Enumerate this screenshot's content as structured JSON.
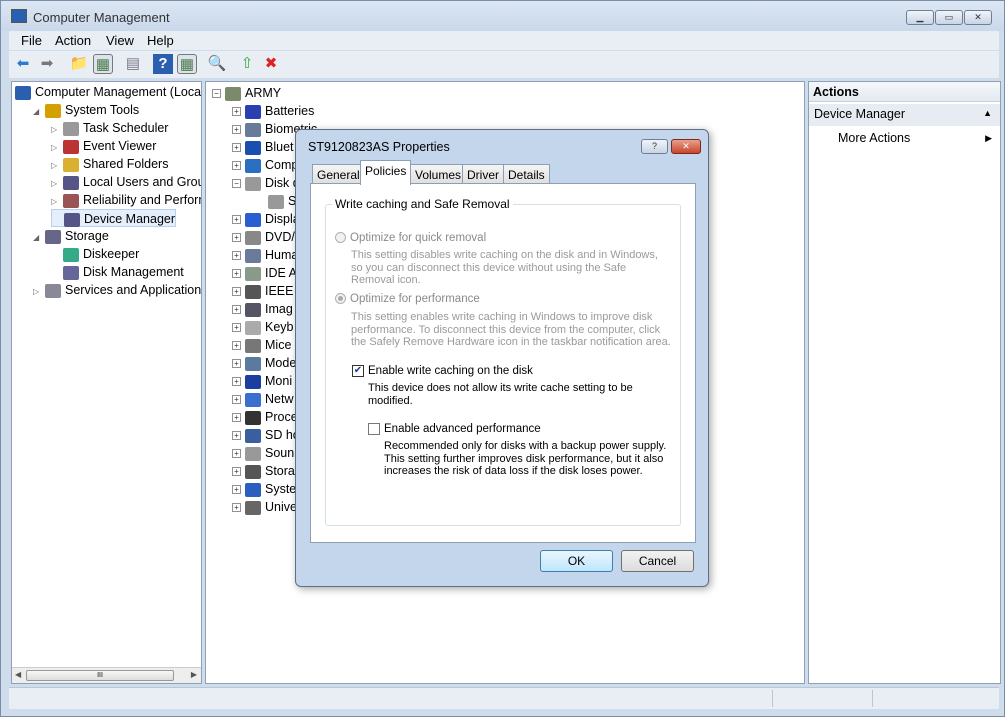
{
  "window": {
    "title": "Computer Management",
    "min": "▁",
    "max": "▭",
    "close": "✕"
  },
  "menu": [
    "File",
    "Action",
    "View",
    "Help"
  ],
  "toolbar": [
    {
      "icon": "back-icon",
      "g": "⬅",
      "c": "#2a7ad0"
    },
    {
      "icon": "forward-icon",
      "g": "➡",
      "c": "#777"
    },
    {
      "icon": "up-folder-icon",
      "g": "📁",
      "c": "#d9a400"
    },
    {
      "icon": "show-hide-console-tree-icon",
      "g": "▦",
      "c": "#4a7a4a"
    },
    {
      "icon": "export-list-icon",
      "g": "▤",
      "c": "#778"
    },
    {
      "icon": "help-icon",
      "g": "?",
      "c": "#fff"
    },
    {
      "icon": "show-hide-action-pane-icon",
      "g": "▦",
      "c": "#4a7a4a"
    },
    {
      "icon": "scan-hardware-icon",
      "g": "🔍",
      "c": "#36a"
    },
    {
      "icon": "update-driver-icon",
      "g": "⇧",
      "c": "#3a3"
    },
    {
      "icon": "uninstall-icon",
      "g": "✖",
      "c": "#d22"
    }
  ],
  "left_tree": [
    {
      "label": "Computer Management (Local",
      "lvl": 0,
      "exp": "",
      "c": "#2a5fb0"
    },
    {
      "label": "System Tools",
      "lvl": 1,
      "exp": "◢",
      "c": "#d4a000"
    },
    {
      "label": "Task Scheduler",
      "lvl": 2,
      "exp": "▷",
      "c": "#999"
    },
    {
      "label": "Event Viewer",
      "lvl": 2,
      "exp": "▷",
      "c": "#b33"
    },
    {
      "label": "Shared Folders",
      "lvl": 2,
      "exp": "▷",
      "c": "#d9b030"
    },
    {
      "label": "Local Users and Groups",
      "lvl": 2,
      "exp": "▷",
      "c": "#558"
    },
    {
      "label": "Reliability and Performa",
      "lvl": 2,
      "exp": "▷",
      "c": "#955"
    },
    {
      "label": "Device Manager",
      "lvl": 2,
      "exp": "",
      "c": "#558",
      "sel": true
    },
    {
      "label": "Storage",
      "lvl": 1,
      "exp": "◢",
      "c": "#668"
    },
    {
      "label": "Diskeeper",
      "lvl": 2,
      "exp": "",
      "c": "#3a8"
    },
    {
      "label": "Disk Management",
      "lvl": 2,
      "exp": "",
      "c": "#669"
    },
    {
      "label": "Services and Applications",
      "lvl": 1,
      "exp": "▷",
      "c": "#889"
    }
  ],
  "device_tree": {
    "root": "ARMY",
    "items": [
      {
        "label": "Batteries",
        "exp": "+"
      },
      {
        "label": "Biometric",
        "exp": "+"
      },
      {
        "label": "Bluet",
        "exp": "+"
      },
      {
        "label": "Comp",
        "exp": "+"
      },
      {
        "label": "Disk d",
        "exp": "−"
      },
      {
        "label": "ST",
        "exp": "",
        "child": true
      },
      {
        "label": "Displa",
        "exp": "+"
      },
      {
        "label": "DVD/",
        "exp": "+"
      },
      {
        "label": "Huma",
        "exp": "+"
      },
      {
        "label": "IDE A",
        "exp": "+"
      },
      {
        "label": "IEEE 1",
        "exp": "+"
      },
      {
        "label": "Imag",
        "exp": "+"
      },
      {
        "label": "Keyb",
        "exp": "+"
      },
      {
        "label": "Mice",
        "exp": "+"
      },
      {
        "label": "Mode",
        "exp": "+"
      },
      {
        "label": "Moni",
        "exp": "+"
      },
      {
        "label": "Netw",
        "exp": "+"
      },
      {
        "label": "Proce",
        "exp": "+"
      },
      {
        "label": "SD ho",
        "exp": "+"
      },
      {
        "label": "Soun",
        "exp": "+"
      },
      {
        "label": "Stora",
        "exp": "+"
      },
      {
        "label": "Syste",
        "exp": "+"
      },
      {
        "label": "Unive",
        "exp": "+"
      }
    ]
  },
  "actions": {
    "header": "Actions",
    "section": "Device Manager",
    "more": "More Actions"
  },
  "scrollbar": {
    "grip": "III",
    "left": "◀",
    "right": "▶"
  },
  "dialog": {
    "title": "ST9120823AS Properties",
    "help": "?",
    "close": "✕",
    "tabs": [
      "General",
      "Policies",
      "Volumes",
      "Driver",
      "Details"
    ],
    "active_tab": "Policies",
    "group": "Write caching and Safe Removal",
    "opt1": "Optimize for quick removal",
    "opt1_desc": "This setting disables write caching on the disk and in Windows, so you can disconnect this device without using the Safe Removal icon.",
    "opt2": "Optimize for performance",
    "opt2_desc": "This setting enables write caching in Windows to improve disk performance. To disconnect this device from the computer, click the Safely Remove Hardware icon in the taskbar notification area.",
    "cb1": "Enable write caching on the disk",
    "cb1_checked": true,
    "cb1_desc": "This device does not allow its write cache setting to be modified.",
    "cb2": "Enable advanced performance",
    "cb2_checked": false,
    "cb2_desc": "Recommended only for disks with a backup power supply. This setting further improves disk performance, but it also increases the risk of data loss if the disk loses power.",
    "ok": "OK",
    "cancel": "Cancel"
  }
}
